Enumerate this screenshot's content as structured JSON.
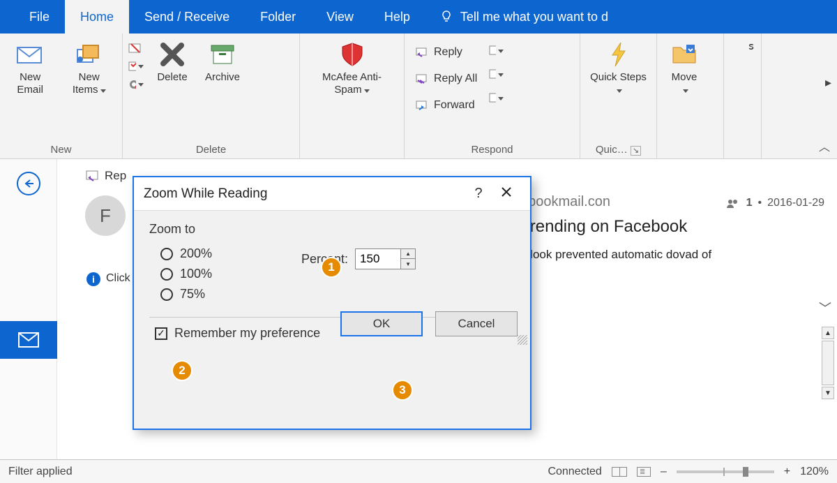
{
  "tabs": {
    "file": "File",
    "home": "Home",
    "sendrecv": "Send / Receive",
    "folder": "Folder",
    "view": "View",
    "help": "Help"
  },
  "tellme": "Tell me what you want to d",
  "ribbon": {
    "new_email": "New Email",
    "new_items": "New Items",
    "delete": "Delete",
    "archive": "Archive",
    "mcafee": "McAfee Anti-Spam",
    "reply": "Reply",
    "reply_all": "Reply All",
    "forward": "Forward",
    "quick_steps": "Quick Steps",
    "move": "Move",
    "overflow": "ꜱ",
    "group_new": "New",
    "group_delete": "Delete",
    "group_respond": "Respond",
    "group_quick": "Quic…"
  },
  "pane": {
    "reply_btn": "Rep",
    "avatar": "F",
    "info": "Click som",
    "from_suffix": "ebookmail.con",
    "subject_suffix": "Trending on Facebook",
    "blocked": "utlook prevented automatic dovad of",
    "meta_count": "1",
    "meta_date": "2016-01-29"
  },
  "dialog": {
    "title": "Zoom While Reading",
    "zoom_to": "Zoom to",
    "opt200": "200%",
    "opt100": "100%",
    "opt75": "75%",
    "percent_label": "Percent:",
    "percent_value": "150",
    "remember": "Remember my preference",
    "ok": "OK",
    "cancel": "Cancel"
  },
  "callouts": {
    "c1": "1",
    "c2": "2",
    "c3": "3"
  },
  "status": {
    "filter": "Filter applied",
    "connected": "Connected",
    "zoom": "120%",
    "minus": "–",
    "plus": "+"
  }
}
